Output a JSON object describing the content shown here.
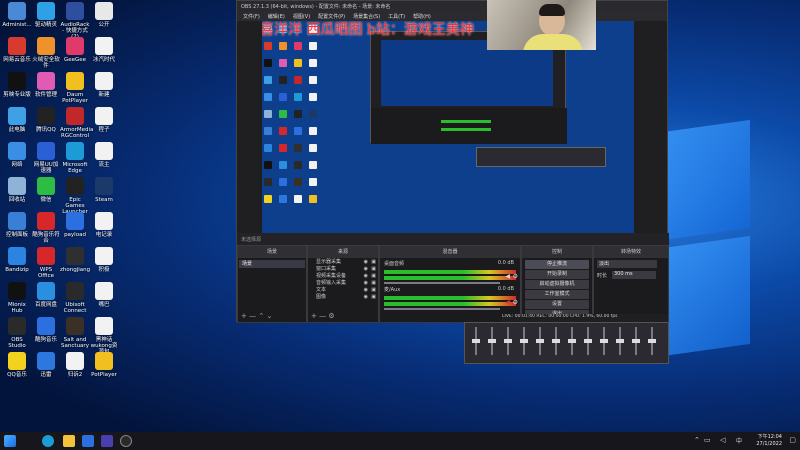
{
  "desktop_icons": [
    {
      "label": "Administ...",
      "color": "#4a89d6"
    },
    {
      "label": "驱动精灵",
      "color": "#2ea0e6"
    },
    {
      "label": "AudioRack - 快捷方式 (2)",
      "color": "#2e4fa0"
    },
    {
      "label": "公开",
      "color": "#e8e8e8"
    },
    {
      "label": "网易云音乐",
      "color": "#d83a2e"
    },
    {
      "label": "火绒安全软件",
      "color": "#f0922b"
    },
    {
      "label": "GeeGee",
      "color": "#e03a6a"
    },
    {
      "label": "冰汽时代",
      "color": "#f2f2f2"
    },
    {
      "label": "剪映专业版",
      "color": "#111111"
    },
    {
      "label": "软件管理",
      "color": "#e05bb4"
    },
    {
      "label": "Daum PotPlayer",
      "color": "#f2c01e"
    },
    {
      "label": "新建",
      "color": "#f2f2f2"
    },
    {
      "label": "此电脑",
      "color": "#3fa0e6"
    },
    {
      "label": "腾讯QQ",
      "color": "#222222"
    },
    {
      "label": "ArmorMedia RGControl",
      "color": "#c0282a"
    },
    {
      "label": "程子",
      "color": "#f2f2f2"
    },
    {
      "label": "网络",
      "color": "#3a8ee6"
    },
    {
      "label": "网易UU加速器",
      "color": "#2a5fd6"
    },
    {
      "label": "Microsoft Edge",
      "color": "#1c9bd6"
    },
    {
      "label": "流主",
      "color": "#f2f2f2"
    },
    {
      "label": "回收站",
      "color": "#8fb3d6"
    },
    {
      "label": "微信",
      "color": "#2dbd42"
    },
    {
      "label": "Epic Games Launcher",
      "color": "#222222"
    },
    {
      "label": "Steam",
      "color": "#1b3a6a"
    },
    {
      "label": "控制面板",
      "color": "#3a7fd6"
    },
    {
      "label": "酷狗音乐符合",
      "color": "#d6282a"
    },
    {
      "label": "payload",
      "color": "#2b6fe0"
    },
    {
      "label": "电记录",
      "color": "#f2f2f2"
    },
    {
      "label": "Bandizip",
      "color": "#2b84e0"
    },
    {
      "label": "WPS Office",
      "color": "#d6282a"
    },
    {
      "label": "zhongjiang",
      "color": "#2f2f2f"
    },
    {
      "label": "积极",
      "color": "#f2f2f2"
    },
    {
      "label": "Mionix Hub",
      "color": "#111111"
    },
    {
      "label": "百度网盘",
      "color": "#2b8fe0"
    },
    {
      "label": "Ubisoft Connect",
      "color": "#2a2a2a"
    },
    {
      "label": "嘴巴",
      "color": "#f2f2f2"
    },
    {
      "label": "OBS Studio",
      "color": "#2a2a2a"
    },
    {
      "label": "酷狗音乐",
      "color": "#2b6fe0"
    },
    {
      "label": "Salt and Sanctuary",
      "color": "#3a3026"
    },
    {
      "label": "黑神话wukong资源包",
      "color": "#f2f2f2"
    },
    {
      "label": "QQ音乐",
      "color": "#f2d21e"
    },
    {
      "label": "迅雷",
      "color": "#2b78e0"
    },
    {
      "label": "归诉2",
      "color": "#f2f2f2"
    },
    {
      "label": "PotPlayer",
      "color": "#f2c01e"
    }
  ],
  "obs": {
    "title": "OBS 27.1.3 (64-bit, windows) - 配置文件: 未命名 - 场景: 未命名",
    "menu": [
      "文件(F)",
      "编辑(E)",
      "视图(V)",
      "配置文件(P)",
      "场景集合(S)",
      "工具(T)",
      "帮助(H)"
    ],
    "banner": "喜洋洋 西瓜晒图 b站：游戏王美神",
    "scenes_header": "场景",
    "scene_item": "场景",
    "sources_header": "来源",
    "sources": [
      "显示器采集",
      "窗口采集",
      "视频采集设备",
      "音频输入采集",
      "文本",
      "图像"
    ],
    "mixer_header": "混音器",
    "mixer_rows": [
      {
        "name": "桌面音频",
        "db": "0.0 dB"
      },
      {
        "name": "麦/Aux",
        "db": "0.0 dB"
      }
    ],
    "controls_header": "控制",
    "controls": [
      "停止推流",
      "开始录制",
      "启动虚拟摄像机",
      "工作室模式",
      "设置",
      "退出"
    ],
    "transitions_header": "转场特效",
    "transition_value": "淡出",
    "duration_label": "时长",
    "duration_value": "300 ms",
    "status": "LIVE: 00:01:40   REC: 00:00:00   CPU: 1.9%, 60.00 fps"
  },
  "taskbar": {
    "time": "下午12:04",
    "date": "27/1/2022"
  }
}
